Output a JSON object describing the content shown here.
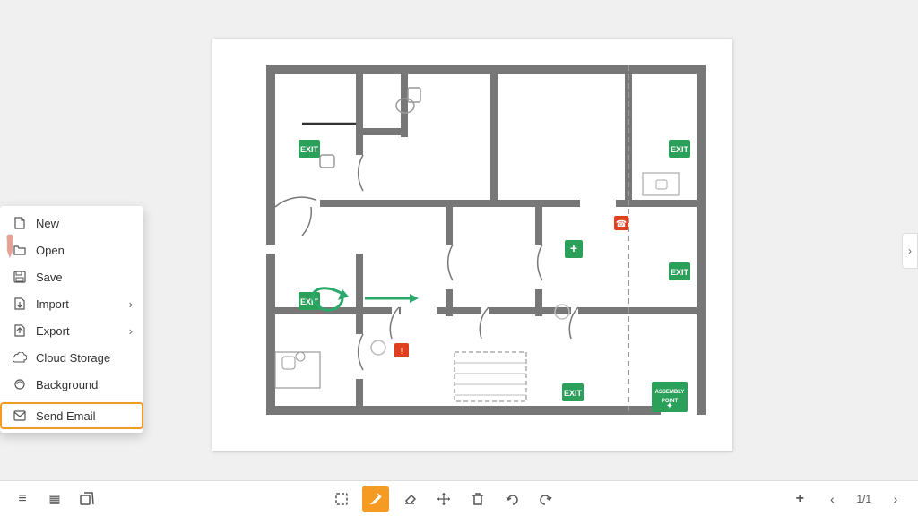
{
  "menu": {
    "items": [
      {
        "id": "new",
        "label": "New",
        "icon": "file-icon",
        "hasArrow": false
      },
      {
        "id": "open",
        "label": "Open",
        "icon": "folder-icon",
        "hasArrow": false
      },
      {
        "id": "save",
        "label": "Save",
        "icon": "save-icon",
        "hasArrow": false
      },
      {
        "id": "import",
        "label": "Import",
        "icon": "import-icon",
        "hasArrow": true
      },
      {
        "id": "export",
        "label": "Export",
        "icon": "export-icon",
        "hasArrow": true
      },
      {
        "id": "cloud-storage",
        "label": "Cloud Storage",
        "icon": "cloud-icon",
        "hasArrow": false
      },
      {
        "id": "background",
        "label": "Background",
        "icon": "background-icon",
        "hasArrow": false
      },
      {
        "id": "send-email",
        "label": "Send Email",
        "icon": "email-icon",
        "hasArrow": false,
        "active": true
      }
    ]
  },
  "toolbar": {
    "left": [
      {
        "id": "menu-btn",
        "icon": "≡",
        "active": false
      },
      {
        "id": "qr-btn",
        "icon": "▦",
        "active": false
      },
      {
        "id": "add-btn",
        "icon": "⊞",
        "active": false
      }
    ],
    "center": [
      {
        "id": "select-btn",
        "icon": "⬜",
        "active": false
      },
      {
        "id": "draw-btn",
        "icon": "✏",
        "active": true
      },
      {
        "id": "erase-btn",
        "icon": "◻",
        "active": false
      },
      {
        "id": "hand-btn",
        "icon": "✋",
        "active": false
      },
      {
        "id": "delete-btn",
        "icon": "🗑",
        "active": false
      },
      {
        "id": "undo-btn",
        "icon": "↩",
        "active": false
      },
      {
        "id": "redo-btn",
        "icon": "↪",
        "active": false
      }
    ],
    "right": {
      "zoom-add": "+",
      "prev": "‹",
      "page": "1/1",
      "next": "›"
    }
  }
}
